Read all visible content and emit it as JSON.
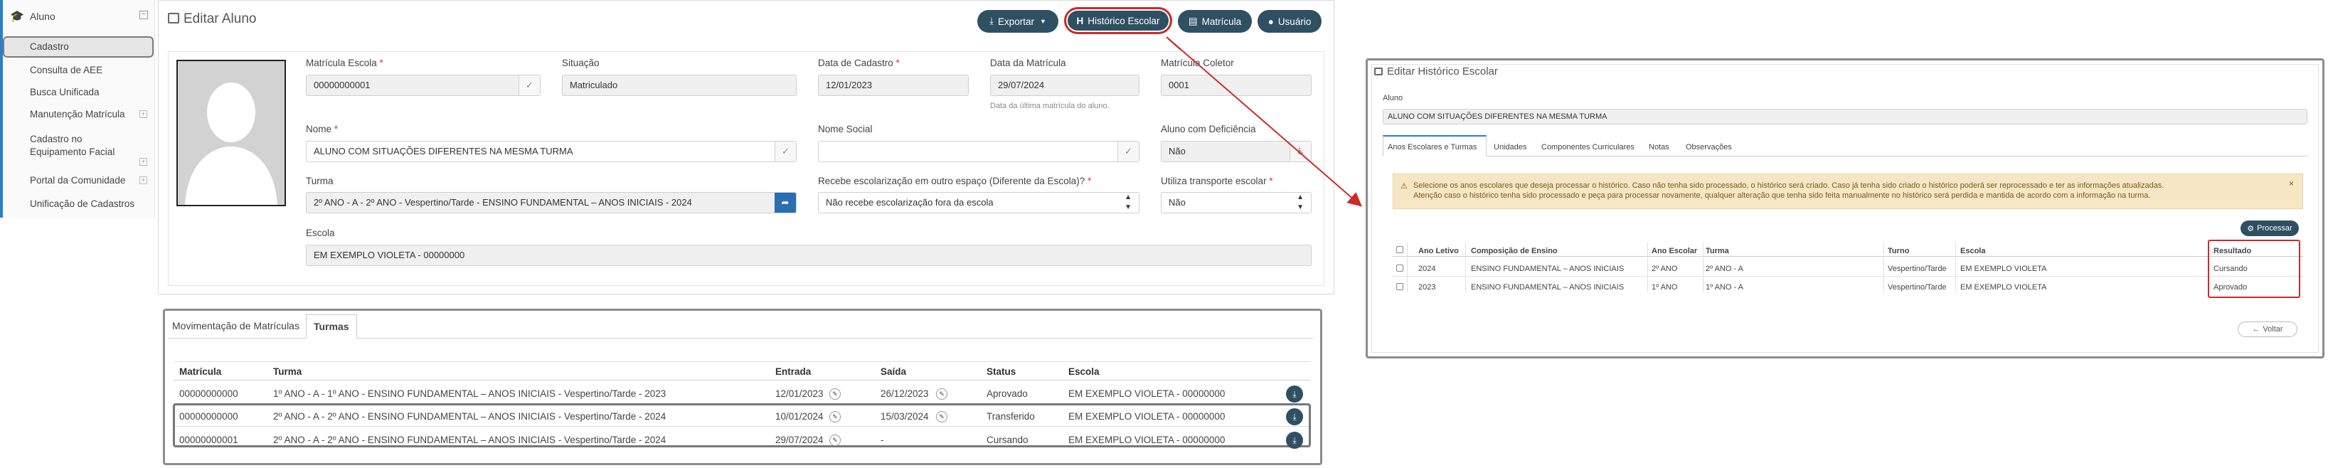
{
  "sidebar": {
    "head_label": "Aluno",
    "items": [
      {
        "label": "Cadastro",
        "active": true
      },
      {
        "label": "Consulta de AEE"
      },
      {
        "label": "Busca Unificada"
      },
      {
        "label": "Manutenção Matrícula",
        "expandable": true
      },
      {
        "label": "Cadastro no Equipamento Facial",
        "expandable": true
      },
      {
        "label": "Portal da Comunidade",
        "expandable": true
      },
      {
        "label": "Unificação de Cadastros"
      }
    ]
  },
  "edit": {
    "title": "Editar Aluno",
    "buttons": {
      "exportar": "Exportar",
      "historico": "Histórico Escolar",
      "matricula": "Matrícula",
      "usuario": "Usuário"
    },
    "fields": {
      "matricula_escola": {
        "label": "Matrícula Escola",
        "value": "00000000001"
      },
      "situacao": {
        "label": "Situação",
        "value": "Matriculado"
      },
      "data_cadastro": {
        "label": "Data de Cadastro",
        "value": "12/01/2023"
      },
      "data_matricula": {
        "label": "Data da Matrícula",
        "value": "29/07/2024",
        "hint": "Data da última matrícula do aluno."
      },
      "matricula_coletor": {
        "label": "Matrícula Coletor",
        "value": "0001"
      },
      "nome": {
        "label": "Nome",
        "value": "ALUNO COM SITUAÇÕES DIFERENTES NA MESMA TURMA"
      },
      "nome_social": {
        "label": "Nome Social",
        "value": ""
      },
      "aluno_deficiencia": {
        "label": "Aluno com Deficiência",
        "value": "Não"
      },
      "turma": {
        "label": "Turma",
        "value": "2º ANO - A - 2º ANO - Vespertino/Tarde - ENSINO FUNDAMENTAL – ANOS INICIAIS - 2024"
      },
      "escolarizacao": {
        "label": "Recebe escolarização em outro espaço (Diferente da Escola)?",
        "value": "Não recebe escolarização fora da escola"
      },
      "transporte": {
        "label": "Utiliza transporte escolar",
        "value": "Não"
      },
      "escola": {
        "label": "Escola",
        "value": "EM EXEMPLO VIOLETA - 00000000"
      }
    }
  },
  "tabs_panel": {
    "tabs": [
      "Movimentação de Matrículas",
      "Turmas"
    ],
    "active_tab": "Turmas",
    "headers": [
      "Matrícula",
      "Turma",
      "Entrada",
      "Saída",
      "Status",
      "Escola"
    ],
    "rows": [
      {
        "matricula": "00000000000",
        "turma": "1º ANO - A - 1º ANO - ENSINO FUNDAMENTAL – ANOS INICIAIS - Vespertino/Tarde - 2023",
        "entrada": "12/01/2023",
        "saida": "26/12/2023",
        "status": "Aprovado",
        "escola": "EM EXEMPLO VIOLETA - 00000000"
      },
      {
        "matricula": "00000000000",
        "turma": "2º ANO - A - 2º ANO - ENSINO FUNDAMENTAL – ANOS INICIAIS - Vespertino/Tarde - 2024",
        "entrada": "10/01/2024",
        "saida": "15/03/2024",
        "status": "Transferido",
        "escola": "EM EXEMPLO VIOLETA - 00000000"
      },
      {
        "matricula": "00000000001",
        "turma": "2º ANO - A - 2º ANO - ENSINO FUNDAMENTAL – ANOS INICIAIS - Vespertino/Tarde - 2024",
        "entrada": "29/07/2024",
        "saida": "-",
        "status": "Cursando",
        "escola": "EM EXEMPLO VIOLETA - 00000000"
      }
    ]
  },
  "historico": {
    "title": "Editar Histórico Escolar",
    "aluno_label": "Aluno",
    "aluno_value": "ALUNO COM SITUAÇÕES DIFERENTES NA MESMA TURMA",
    "tabs": [
      "Anos Escolares e Turmas",
      "Unidades",
      "Componentes Curriculares",
      "Notas",
      "Observações"
    ],
    "alert_line1": "Selecione os anos escolares que deseja processar o histórico. Caso não tenha sido processado, o histórico será criado. Caso já tenha sido criado o histórico poderá ser reprocessado e ter as informações atualizadas.",
    "alert_line2": "Atenção caso o histórico tenha sido processado e peça para processar novamente, qualquer alteração que tenha sido feita manualmente no histórico será perdida e mantida de acordo com a informação na turma.",
    "processar": "Processar",
    "headers": [
      "Ano Letivo",
      "Composição de Ensino",
      "Ano Escolar",
      "Turma",
      "Turno",
      "Escola",
      "Resultado"
    ],
    "rows": [
      {
        "ano": "2024",
        "composicao": "ENSINO FUNDAMENTAL – ANOS INICIAIS",
        "ano_escolar": "2º ANO",
        "turma": "2º ANO - A",
        "turno": "Vespertino/Tarde",
        "escola": "EM EXEMPLO VIOLETA",
        "resultado": "Cursando"
      },
      {
        "ano": "2023",
        "composicao": "ENSINO FUNDAMENTAL – ANOS INICIAIS",
        "ano_escolar": "1º ANO",
        "turma": "1º ANO - A",
        "turno": "Vespertino/Tarde",
        "escola": "EM EXEMPLO VIOLETA",
        "resultado": "Aprovado"
      }
    ],
    "voltar": "Voltar"
  },
  "colors": {
    "accent": "#2b7fc2",
    "button": "#2f4f63",
    "highlight": "#cc2b2b",
    "alert_bg": "#f6e6c4"
  }
}
